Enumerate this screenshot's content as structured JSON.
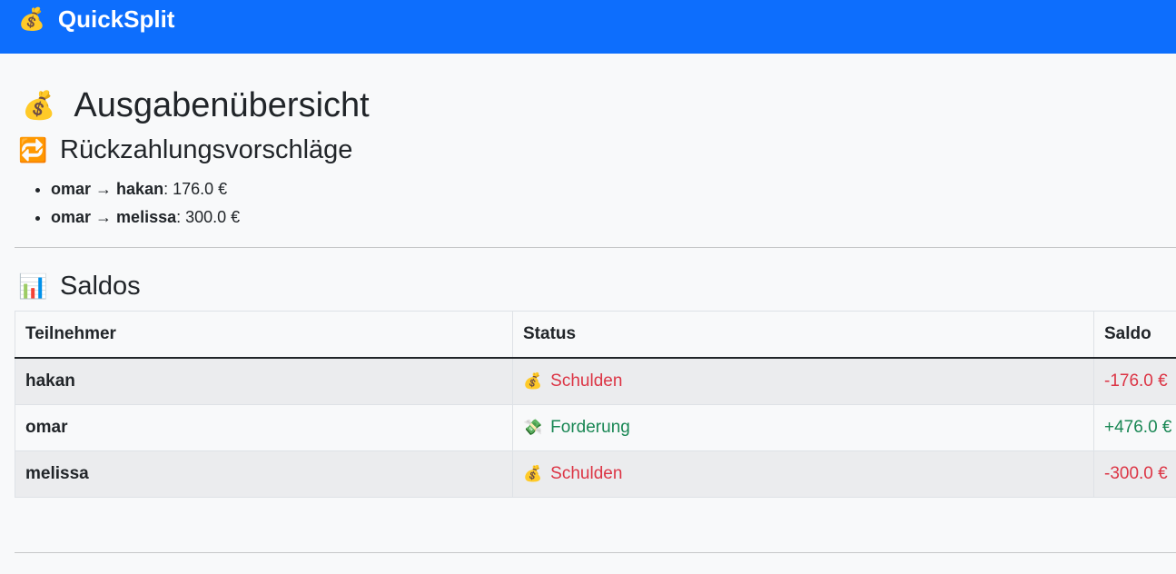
{
  "app": {
    "brand_icon": "money-bag-icon",
    "brand_emoji": "💰",
    "brand_name": "QuickSplit",
    "brand_color": "#0d6efd"
  },
  "page": {
    "title_emoji": "💰",
    "title": "Ausgabenübersicht"
  },
  "refunds": {
    "title_emoji": "🔁",
    "title": "Rückzahlungsvorschläge",
    "items": [
      {
        "from": "omar",
        "arrow": "→",
        "to": "hakan",
        "amount": ": 176.0 €"
      },
      {
        "from": "omar",
        "arrow": "→",
        "to": "melissa",
        "amount": ": 300.0 €"
      }
    ]
  },
  "balances": {
    "title_emoji": "📊",
    "title": "Saldos",
    "headers": [
      "Teilnehmer",
      "Status",
      "Saldo"
    ],
    "rows": [
      {
        "name": "hakan",
        "status_emoji": "💰",
        "status_icon": "money-bag-icon",
        "status": "Schulden",
        "saldo": "-176.0 €",
        "tone": "#dc3545"
      },
      {
        "name": "omar",
        "status_emoji": "💸",
        "status_icon": "money-wings-icon",
        "status": "Forderung",
        "saldo": "+476.0 €",
        "tone": "#198754"
      },
      {
        "name": "melissa",
        "status_emoji": "💰",
        "status_icon": "money-bag-icon",
        "status": "Schulden",
        "saldo": "-300.0 €",
        "tone": "#dc3545"
      }
    ]
  }
}
